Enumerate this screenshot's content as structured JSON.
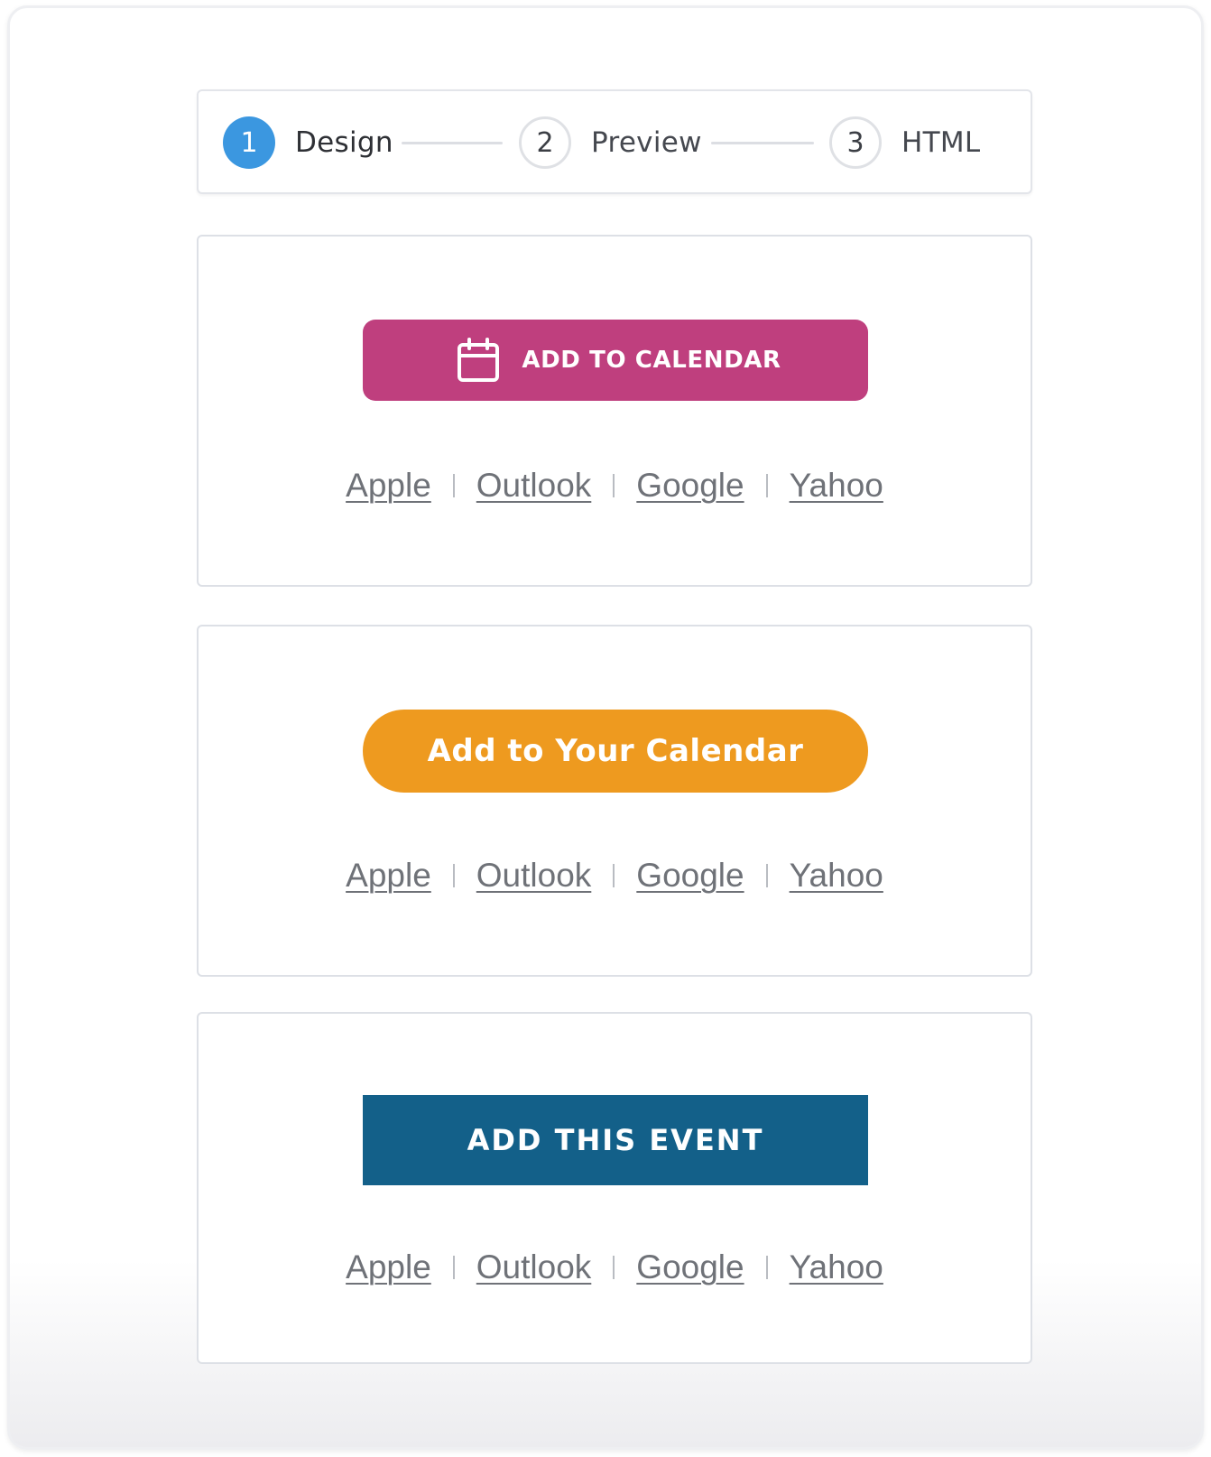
{
  "stepper": {
    "steps": [
      {
        "number": "1",
        "label": "Design",
        "active": true
      },
      {
        "number": "2",
        "label": "Preview",
        "active": false
      },
      {
        "number": "3",
        "label": "HTML",
        "active": false
      }
    ]
  },
  "cards": [
    {
      "button_label": "ADD TO CALENDAR",
      "button_color": "#bf3f7e",
      "button_icon": "calendar-icon",
      "links": [
        "Apple",
        "Outlook",
        "Google",
        "Yahoo"
      ]
    },
    {
      "button_label": "Add to Your Calendar",
      "button_color": "#ee9a1f",
      "links": [
        "Apple",
        "Outlook",
        "Google",
        "Yahoo"
      ]
    },
    {
      "button_label": "ADD THIS EVENT",
      "button_color": "#136089",
      "links": [
        "Apple",
        "Outlook",
        "Google",
        "Yahoo"
      ]
    }
  ],
  "colors": {
    "step_active": "#3b97e0",
    "link_text": "#6f7278"
  }
}
